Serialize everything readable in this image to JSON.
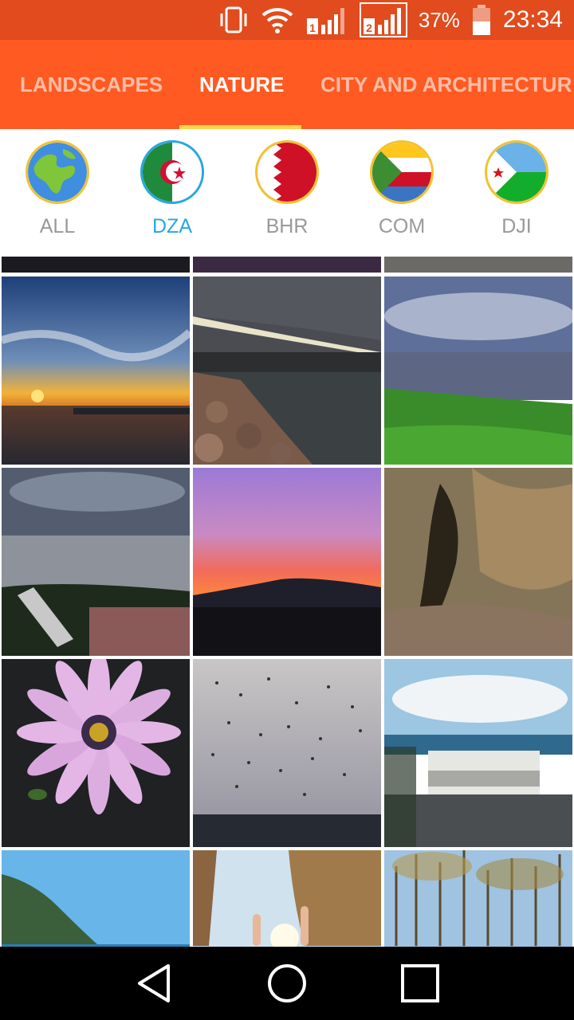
{
  "status_bar": {
    "battery_percent": "37%",
    "time": "23:34",
    "icons": [
      "vibrate-icon",
      "wifi-icon",
      "signal-sim1-icon",
      "signal-sim2-icon",
      "battery-icon"
    ]
  },
  "tabs": [
    {
      "label": "LANDSCAPES",
      "active": false
    },
    {
      "label": "NATURE",
      "active": true
    },
    {
      "label": "CITY AND ARCHITECTUR",
      "active": false
    }
  ],
  "countries": [
    {
      "code": "ALL",
      "icon": "globe-icon",
      "active": false
    },
    {
      "code": "DZA",
      "icon": "algeria-flag-icon",
      "active": true
    },
    {
      "code": "BHR",
      "icon": "bahrain-flag-icon",
      "active": false
    },
    {
      "code": "COM",
      "icon": "comoros-flag-icon",
      "active": false
    },
    {
      "code": "DJI",
      "icon": "djibouti-flag-icon",
      "active": false
    }
  ],
  "photos": [
    "sunset-over-sea",
    "rocky-breakwater",
    "sea-and-grass",
    "sea-with-bench",
    "purple-sunset-hills",
    "rock-cave",
    "purple-daisy",
    "bird-flock-sky",
    "blurred-building-sea",
    "coastal-cliff",
    "sun-through-rocks",
    "bare-trees"
  ],
  "nav": {
    "icons": [
      "back-icon",
      "home-icon",
      "recents-icon"
    ]
  },
  "colors": {
    "status_bar": "#e14b1d",
    "tab_bar": "#ff5a22",
    "indicator": "#ffd54a",
    "active_country": "#27a7e0"
  }
}
